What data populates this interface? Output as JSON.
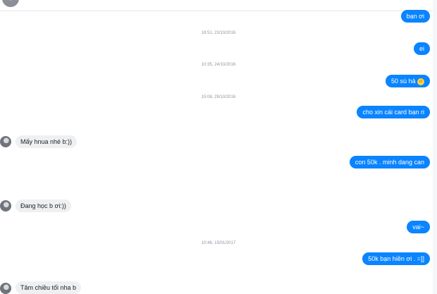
{
  "conversation": {
    "messages_right": [
      {
        "text": "bạn ơi"
      },
      {
        "text": "ei"
      },
      {
        "text": "50 sù hả"
      },
      {
        "text": "cho xin cái card bạn ri"
      },
      {
        "text": "con 50k . minh dang can"
      },
      {
        "text": "vai~"
      },
      {
        "text": "50k bạn hiền ơi . =]]"
      }
    ],
    "messages_left": [
      {
        "text": "Mấy hnua nhé b:))"
      },
      {
        "text": "Đang học b ơi:))"
      },
      {
        "text": "Tâm chiều tối nha b"
      }
    ],
    "timestamps": [
      "18:51, 23/10/2016",
      "10:35, 24/10/2016",
      "15:08, 29/10/2016",
      "10:46, 15/01/2017"
    ],
    "emoji": {
      "name": "smiley-emoji",
      "glyph": "☺"
    }
  },
  "colors": {
    "outgoing_bubble": "#0a84ff",
    "incoming_bubble": "#eef0f2",
    "timestamp": "#8d949e"
  }
}
